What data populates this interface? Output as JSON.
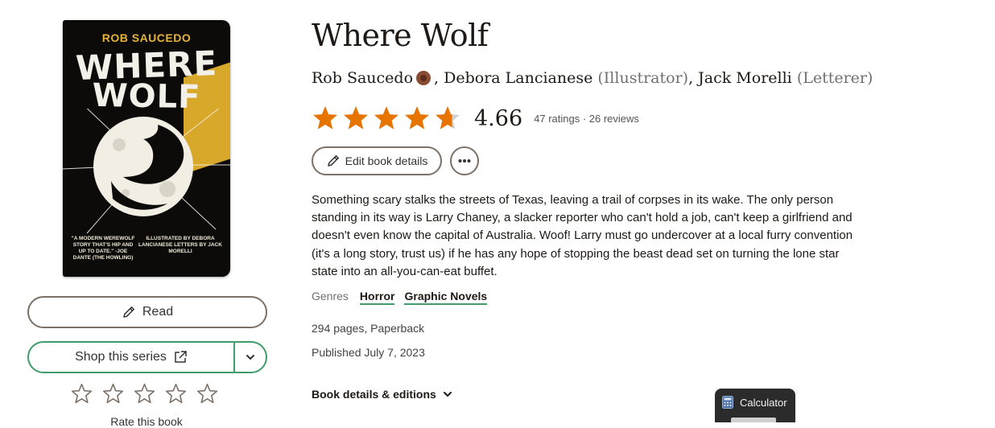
{
  "cover": {
    "author": "ROB SAUCEDO",
    "title_line1": "WHERE",
    "title_line2": "WOLF",
    "quote": "\"A MODERN WEREWOLF STORY THAT'S HIP AND UP TO DATE.\" -JOE DANTE (THE HOWLING)",
    "credit": "ILLUSTRATED BY DEBORA LANCIANESE LETTERS BY JACK MORELLI"
  },
  "actions": {
    "read_label": "Read",
    "shop_label": "Shop this series",
    "rate_label": "Rate this book",
    "user_rating_stars": 5
  },
  "book": {
    "title": "Where Wolf",
    "author": "Rob Saucedo",
    "contributors": [
      {
        "name": "Debora Lancianese",
        "role": "(Illustrator)"
      },
      {
        "name": "Jack Morelli",
        "role": "(Letterer)"
      }
    ],
    "average_rating": "4.66",
    "rating_fill": 4.66,
    "ratings_meta": "47 ratings · 26 reviews",
    "edit_label": "Edit book details",
    "description": "Something scary stalks the streets of Texas, leaving a trail of corpses in its wake. The only person standing in its way is Larry Chaney, a slacker reporter who can't hold a job, can't keep a girlfriend and doesn't even know the capital of Australia. Woof! Larry must go undercover at a local furry convention (it's a long story, trust us) if he has any hope of stopping the beast dead set on turning the lone star state into an all-you-can-eat buffet.",
    "genres_label": "Genres",
    "genres": [
      "Horror",
      "Graphic Novels"
    ],
    "pages": "294 pages, Paperback",
    "published": "Published July 7, 2023",
    "details_label": "Book details & editions"
  },
  "taskbar": {
    "app_name": "Calculator",
    "icon": "calculator-icon"
  },
  "colors": {
    "star": "#e87400",
    "star_empty": "#cfcfcf",
    "accent_green": "#409d69",
    "button_border": "#7d7066"
  }
}
